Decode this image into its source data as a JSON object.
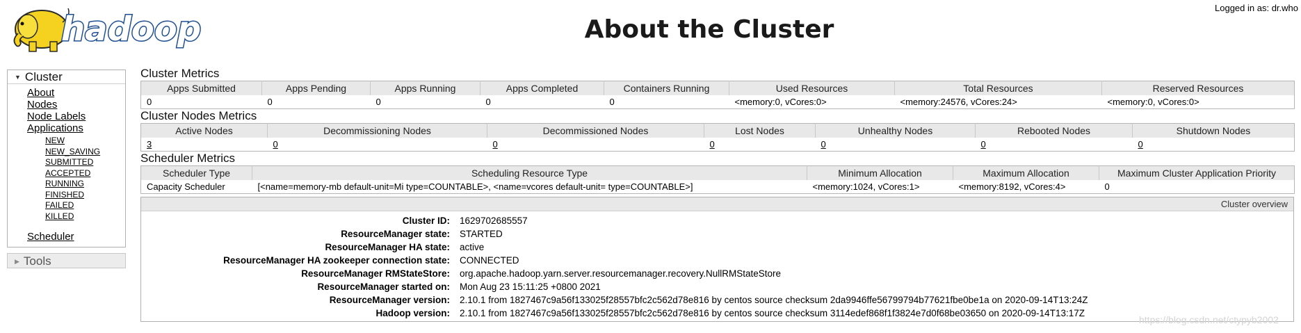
{
  "header": {
    "logo_text": "hadoop",
    "title": "About the Cluster",
    "login": "Logged in as: dr.who"
  },
  "nav": {
    "cluster_label": "Cluster",
    "items": [
      "About",
      "Nodes",
      "Node Labels",
      "Applications"
    ],
    "app_states": [
      "NEW",
      "NEW_SAVING",
      "SUBMITTED",
      "ACCEPTED",
      "RUNNING",
      "FINISHED",
      "FAILED",
      "KILLED"
    ],
    "scheduler": "Scheduler",
    "tools_label": "Tools"
  },
  "cluster_metrics": {
    "title": "Cluster Metrics",
    "headers": [
      "Apps Submitted",
      "Apps Pending",
      "Apps Running",
      "Apps Completed",
      "Containers Running",
      "Used Resources",
      "Total Resources",
      "Reserved Resources"
    ],
    "values": [
      "0",
      "0",
      "0",
      "0",
      "0",
      "<memory:0, vCores:0>",
      "<memory:24576, vCores:24>",
      "<memory:0, vCores:0>"
    ]
  },
  "node_metrics": {
    "title": "Cluster Nodes Metrics",
    "headers": [
      "Active Nodes",
      "Decommissioning Nodes",
      "Decommissioned Nodes",
      "Lost Nodes",
      "Unhealthy Nodes",
      "Rebooted Nodes",
      "Shutdown Nodes"
    ],
    "values": [
      "3",
      "0",
      "0",
      "0",
      "0",
      "0",
      "0"
    ]
  },
  "scheduler_metrics": {
    "title": "Scheduler Metrics",
    "headers": [
      "Scheduler Type",
      "Scheduling Resource Type",
      "Minimum Allocation",
      "Maximum Allocation",
      "Maximum Cluster Application Priority"
    ],
    "values": [
      "Capacity Scheduler",
      "[<name=memory-mb default-unit=Mi type=COUNTABLE>, <name=vcores default-unit= type=COUNTABLE>]",
      "<memory:1024, vCores:1>",
      "<memory:8192, vCores:4>",
      "0"
    ]
  },
  "overview": {
    "header": "Cluster overview",
    "rows": [
      {
        "key": "Cluster ID:",
        "value": "1629702685557"
      },
      {
        "key": "ResourceManager state:",
        "value": "STARTED"
      },
      {
        "key": "ResourceManager HA state:",
        "value": "active"
      },
      {
        "key": "ResourceManager HA zookeeper connection state:",
        "value": "CONNECTED"
      },
      {
        "key": "ResourceManager RMStateStore:",
        "value": "org.apache.hadoop.yarn.server.resourcemanager.recovery.NullRMStateStore"
      },
      {
        "key": "ResourceManager started on:",
        "value": "Mon Aug 23 15:11:25 +0800 2021"
      },
      {
        "key": "ResourceManager version:",
        "value": "2.10.1 from 1827467c9a56f133025f28557bfc2c562d78e816 by centos source checksum 2da9946ffe56799794b77621fbe0be1a on 2020-09-14T13:24Z"
      },
      {
        "key": "Hadoop version:",
        "value": "2.10.1 from 1827467c9a56f133025f28557bfc2c562d78e816 by centos source checksum 3114edef868f1f3824e7d0f68be03650 on 2020-09-14T13:17Z"
      }
    ]
  },
  "watermark": "https://blog.csdn.net/ctypyb2002",
  "colors": {
    "logo_yellow": "#f4d21f",
    "logo_blue": "#2b6cb0",
    "header_gray": "#e8e8e8"
  }
}
